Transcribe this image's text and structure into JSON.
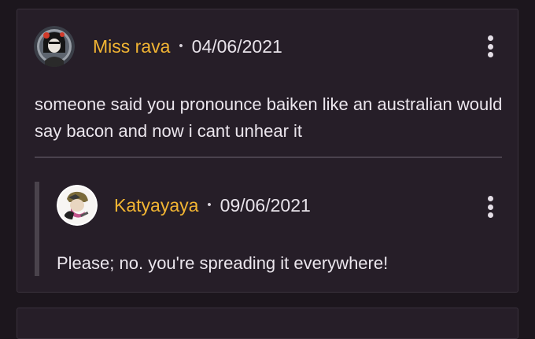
{
  "comment": {
    "username": "Miss rava",
    "separator": "•",
    "date": "04/06/2021",
    "text": "someone said you pronounce baiken like an australian would say bacon and now i cant unhear it",
    "avatar_icon": "user-avatar-icon",
    "menu_icon": "more-vertical-icon"
  },
  "reply": {
    "username": "Katyayaya",
    "separator": "•",
    "date": "09/06/2021",
    "text": "Please; no. you're spreading it everywhere!",
    "avatar_icon": "user-avatar-icon",
    "menu_icon": "more-vertical-icon"
  },
  "colors": {
    "background": "#1c161d",
    "card": "#261e28",
    "username": "#f2b533",
    "text": "#ebe6ed"
  }
}
